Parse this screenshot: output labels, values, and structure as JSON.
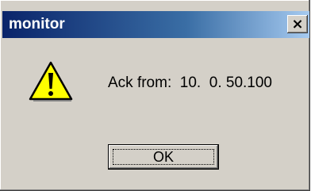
{
  "window": {
    "title": "monitor",
    "close_symbol": "×"
  },
  "dialog": {
    "icon": "warning-icon",
    "message": "Ack from:  10.  0. 50.100",
    "ok_label": "OK"
  },
  "colors": {
    "titlebar_start": "#0a246a",
    "titlebar_end": "#a6caf0",
    "face": "#d4d0c8",
    "warning_yellow": "#ffff00"
  }
}
